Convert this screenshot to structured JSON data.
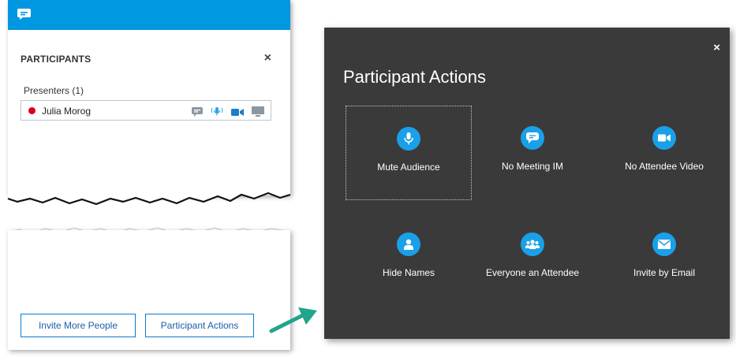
{
  "participants_pane": {
    "section_title": "PARTICIPANTS",
    "close_glyph": "×",
    "group_label": "Presenters (1)",
    "presenter": {
      "name": "Julia Morog",
      "presence_color": "#d9001b",
      "icons": [
        "chat-icon",
        "microphone-icon",
        "video-icon",
        "screen-share-icon"
      ]
    },
    "buttons": {
      "invite": "Invite More People",
      "participant_actions": "Participant Actions"
    },
    "accent_color": "#0098e0"
  },
  "dialog": {
    "title": "Participant Actions",
    "close_glyph": "×",
    "background_color": "#3a3a3a",
    "icon_color": "#1aa0e8",
    "actions": [
      {
        "label": "Mute Audience",
        "icon": "microphone-icon"
      },
      {
        "label": "No Meeting IM",
        "icon": "chat-icon"
      },
      {
        "label": "No Attendee Video",
        "icon": "video-icon"
      },
      {
        "label": "Hide Names",
        "icon": "person-icon"
      },
      {
        "label": "Everyone an Attendee",
        "icon": "people-group-icon"
      },
      {
        "label": "Invite by Email",
        "icon": "email-icon"
      }
    ]
  }
}
